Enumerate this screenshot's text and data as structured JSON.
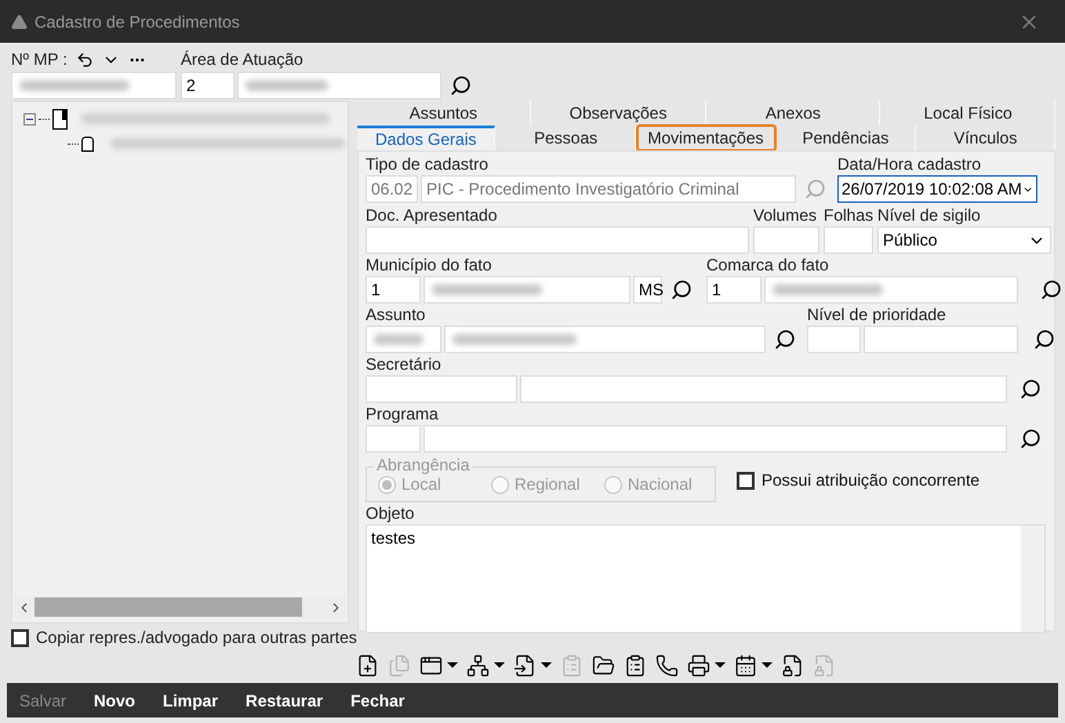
{
  "window": {
    "title": "Cadastro de Procedimentos"
  },
  "header": {
    "mp_label": "Nº MP :",
    "area_label": "Área de Atuação",
    "area_code": "2"
  },
  "tree": {
    "expanded": true
  },
  "copy_checkbox": {
    "label": "Copiar repres./advogado para outras partes",
    "checked": false
  },
  "tabs_row_1": [
    {
      "label": "Assuntos",
      "selected": false,
      "highlighted": false
    },
    {
      "label": "Observações",
      "selected": false,
      "highlighted": false
    },
    {
      "label": "Anexos",
      "selected": false,
      "highlighted": false
    },
    {
      "label": "Local Físico",
      "selected": false,
      "highlighted": false
    }
  ],
  "tabs_row_2": [
    {
      "label": "Dados Gerais",
      "selected": true,
      "highlighted": false
    },
    {
      "label": "Pessoas",
      "selected": false,
      "highlighted": false
    },
    {
      "label": "Movimentações",
      "selected": false,
      "highlighted": true
    },
    {
      "label": "Pendências",
      "selected": false,
      "highlighted": false
    },
    {
      "label": "Vínculos",
      "selected": false,
      "highlighted": false
    }
  ],
  "form": {
    "tipo_label": "Tipo de cadastro",
    "tipo_code": "06.02",
    "tipo_desc": "PIC - Procedimento Investigatório Criminal",
    "tipo_disabled": true,
    "data_label": "Data/Hora cadastro",
    "data_value": "26/07/2019 10:02:08 AM",
    "doc_label": "Doc. Apresentado",
    "volumes_label": "Volumes",
    "folhas_label": "Folhas",
    "sigilo_label": "Nível de sigilo",
    "sigilo_value": "Público",
    "municipio_label": "Município do fato",
    "municipio_code": "1",
    "municipio_uf": "MS",
    "comarca_label": "Comarca do fato",
    "comarca_code": "1",
    "assunto_label": "Assunto",
    "prioridade_label": "Nível de prioridade",
    "secretario_label": "Secretário",
    "programa_label": "Programa",
    "abrangencia": {
      "label": "Abrangência",
      "disabled": true,
      "options": [
        {
          "label": "Local",
          "selected": true
        },
        {
          "label": "Regional",
          "selected": false
        },
        {
          "label": "Nacional",
          "selected": false
        }
      ]
    },
    "concorrente": {
      "label": "Possui atribuição concorrente",
      "checked": false
    },
    "objeto_label": "Objeto",
    "objeto_value": "testes"
  },
  "toolbar": [
    {
      "kind": "file-plus",
      "disabled": false,
      "dropdown": false
    },
    {
      "kind": "file-copy",
      "disabled": true,
      "dropdown": false
    },
    {
      "kind": "window",
      "disabled": false,
      "dropdown": true
    },
    {
      "kind": "hierarchy",
      "disabled": false,
      "dropdown": true
    },
    {
      "kind": "files-arrow",
      "disabled": false,
      "dropdown": true
    },
    {
      "kind": "clipboard",
      "disabled": true,
      "dropdown": false
    },
    {
      "kind": "folder-open",
      "disabled": false,
      "dropdown": false
    },
    {
      "kind": "clipboard",
      "disabled": false,
      "dropdown": false
    },
    {
      "kind": "phone",
      "disabled": false,
      "dropdown": false
    },
    {
      "kind": "printer",
      "disabled": false,
      "dropdown": true
    },
    {
      "kind": "calendar",
      "disabled": false,
      "dropdown": true
    },
    {
      "kind": "file-lock",
      "disabled": false,
      "dropdown": false
    },
    {
      "kind": "file-lock",
      "disabled": true,
      "dropdown": false
    }
  ],
  "footer_buttons": [
    {
      "label": "Salvar",
      "disabled": true
    },
    {
      "label": "Novo",
      "disabled": false
    },
    {
      "label": "Limpar",
      "disabled": false
    },
    {
      "label": "Restaurar",
      "disabled": false
    },
    {
      "label": "Fechar",
      "disabled": false
    }
  ]
}
